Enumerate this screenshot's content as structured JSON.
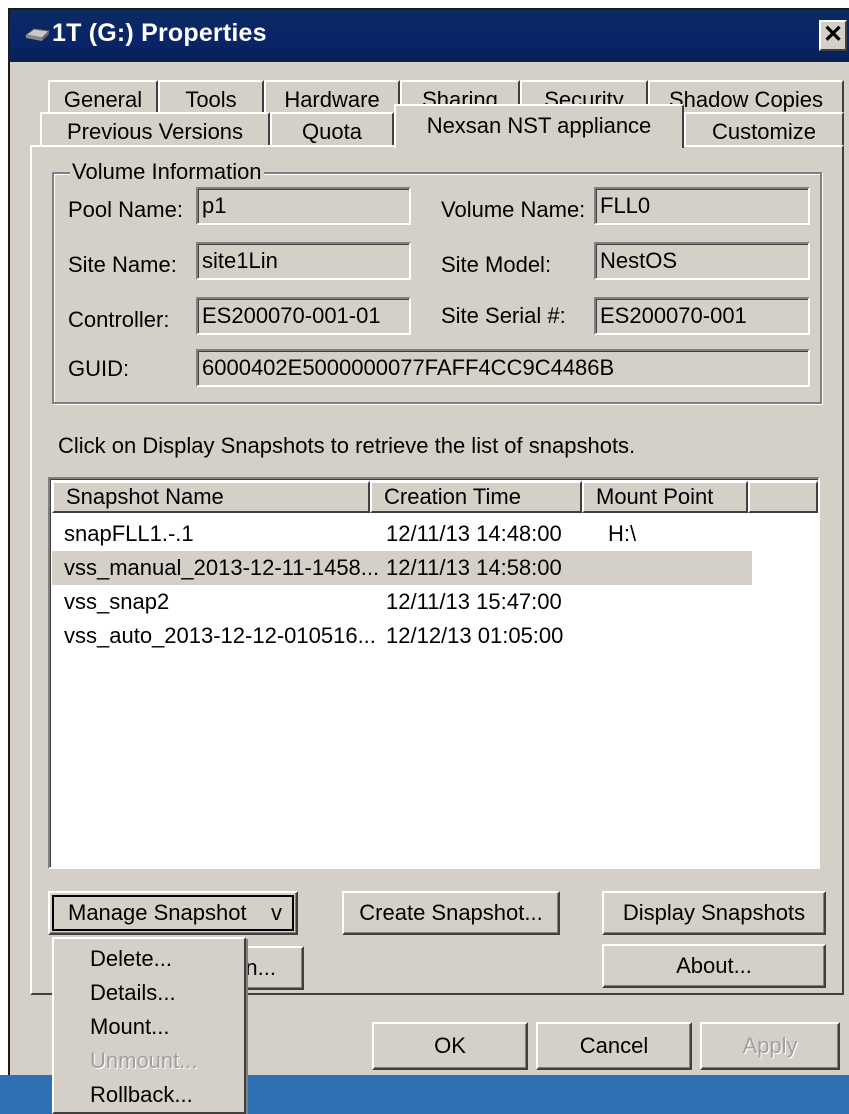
{
  "window": {
    "title": "1T (G:) Properties",
    "close_label": "✕"
  },
  "tabs_row1": [
    {
      "label": "General"
    },
    {
      "label": "Tools"
    },
    {
      "label": "Hardware"
    },
    {
      "label": "Sharing"
    },
    {
      "label": "Security"
    },
    {
      "label": "Shadow Copies"
    }
  ],
  "tabs_row2": [
    {
      "label": "Previous Versions"
    },
    {
      "label": "Quota"
    },
    {
      "label": "Nexsan NST appliance",
      "active": true
    },
    {
      "label": "Customize"
    }
  ],
  "volume_info": {
    "legend": "Volume Information",
    "pool_name_label": "Pool Name:",
    "pool_name_value": "p1",
    "volume_name_label": "Volume Name:",
    "volume_name_value": "FLL0",
    "site_name_label": "Site Name:",
    "site_name_value": "site1Lin",
    "site_model_label": "Site Model:",
    "site_model_value": "NestOS",
    "controller_label": "Controller:",
    "controller_value": "ES200070-001-01",
    "site_serial_label": "Site Serial #:",
    "site_serial_value": "ES200070-001",
    "guid_label": "GUID:",
    "guid_value": "6000402E5000000077FAFF4CC9C4486B"
  },
  "hint_text": "Click on Display Snapshots to retrieve the list of snapshots.",
  "snapshot_list": {
    "columns": [
      "Snapshot Name",
      "Creation Time",
      "Mount Point"
    ],
    "rows": [
      {
        "name": "snapFLL1.-.1",
        "time": "12/11/13 14:48:00",
        "mount": "H:\\",
        "selected": false
      },
      {
        "name": "vss_manual_2013-12-11-1458...",
        "time": "12/11/13 14:58:00",
        "mount": "",
        "selected": true
      },
      {
        "name": "vss_snap2",
        "time": "12/11/13 15:47:00",
        "mount": "",
        "selected": false
      },
      {
        "name": "vss_auto_2013-12-12-010516...",
        "time": "12/12/13 01:05:00",
        "mount": "",
        "selected": false
      }
    ]
  },
  "buttons": {
    "manage_snapshot": "Manage Snapshot",
    "manage_snapshot_arrow": "v",
    "create_snapshot": "Create Snapshot...",
    "display_snapshots": "Display Snapshots",
    "hidden_button_tail": "n...",
    "about": "About...",
    "ok": "OK",
    "cancel": "Cancel",
    "apply": "Apply"
  },
  "manage_menu": {
    "items": [
      {
        "label": "Delete...",
        "enabled": true
      },
      {
        "label": "Details...",
        "enabled": true
      },
      {
        "label": "Mount...",
        "enabled": true
      },
      {
        "label": "Unmount...",
        "enabled": false
      },
      {
        "label": "Rollback...",
        "enabled": true
      }
    ]
  },
  "colors": {
    "titlebar": "#0a246a",
    "face": "#d4d0c8",
    "taskbar": "#2f6fb3"
  }
}
